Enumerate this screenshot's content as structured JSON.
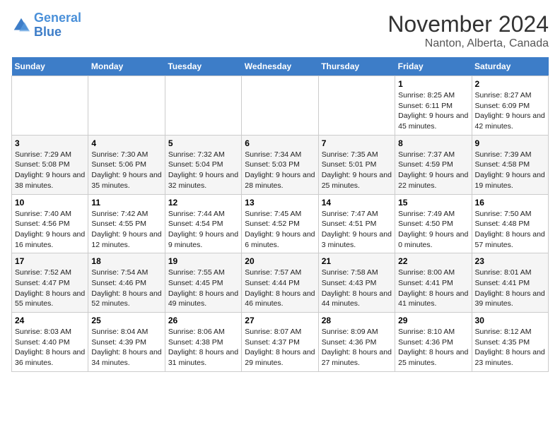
{
  "header": {
    "logo_line1": "General",
    "logo_line2": "Blue",
    "month": "November 2024",
    "location": "Nanton, Alberta, Canada"
  },
  "days_of_week": [
    "Sunday",
    "Monday",
    "Tuesday",
    "Wednesday",
    "Thursday",
    "Friday",
    "Saturday"
  ],
  "weeks": [
    [
      {
        "day": "",
        "info": ""
      },
      {
        "day": "",
        "info": ""
      },
      {
        "day": "",
        "info": ""
      },
      {
        "day": "",
        "info": ""
      },
      {
        "day": "",
        "info": ""
      },
      {
        "day": "1",
        "info": "Sunrise: 8:25 AM\nSunset: 6:11 PM\nDaylight: 9 hours and 45 minutes."
      },
      {
        "day": "2",
        "info": "Sunrise: 8:27 AM\nSunset: 6:09 PM\nDaylight: 9 hours and 42 minutes."
      }
    ],
    [
      {
        "day": "3",
        "info": "Sunrise: 7:29 AM\nSunset: 5:08 PM\nDaylight: 9 hours and 38 minutes."
      },
      {
        "day": "4",
        "info": "Sunrise: 7:30 AM\nSunset: 5:06 PM\nDaylight: 9 hours and 35 minutes."
      },
      {
        "day": "5",
        "info": "Sunrise: 7:32 AM\nSunset: 5:04 PM\nDaylight: 9 hours and 32 minutes."
      },
      {
        "day": "6",
        "info": "Sunrise: 7:34 AM\nSunset: 5:03 PM\nDaylight: 9 hours and 28 minutes."
      },
      {
        "day": "7",
        "info": "Sunrise: 7:35 AM\nSunset: 5:01 PM\nDaylight: 9 hours and 25 minutes."
      },
      {
        "day": "8",
        "info": "Sunrise: 7:37 AM\nSunset: 4:59 PM\nDaylight: 9 hours and 22 minutes."
      },
      {
        "day": "9",
        "info": "Sunrise: 7:39 AM\nSunset: 4:58 PM\nDaylight: 9 hours and 19 minutes."
      }
    ],
    [
      {
        "day": "10",
        "info": "Sunrise: 7:40 AM\nSunset: 4:56 PM\nDaylight: 9 hours and 16 minutes."
      },
      {
        "day": "11",
        "info": "Sunrise: 7:42 AM\nSunset: 4:55 PM\nDaylight: 9 hours and 12 minutes."
      },
      {
        "day": "12",
        "info": "Sunrise: 7:44 AM\nSunset: 4:54 PM\nDaylight: 9 hours and 9 minutes."
      },
      {
        "day": "13",
        "info": "Sunrise: 7:45 AM\nSunset: 4:52 PM\nDaylight: 9 hours and 6 minutes."
      },
      {
        "day": "14",
        "info": "Sunrise: 7:47 AM\nSunset: 4:51 PM\nDaylight: 9 hours and 3 minutes."
      },
      {
        "day": "15",
        "info": "Sunrise: 7:49 AM\nSunset: 4:50 PM\nDaylight: 9 hours and 0 minutes."
      },
      {
        "day": "16",
        "info": "Sunrise: 7:50 AM\nSunset: 4:48 PM\nDaylight: 8 hours and 57 minutes."
      }
    ],
    [
      {
        "day": "17",
        "info": "Sunrise: 7:52 AM\nSunset: 4:47 PM\nDaylight: 8 hours and 55 minutes."
      },
      {
        "day": "18",
        "info": "Sunrise: 7:54 AM\nSunset: 4:46 PM\nDaylight: 8 hours and 52 minutes."
      },
      {
        "day": "19",
        "info": "Sunrise: 7:55 AM\nSunset: 4:45 PM\nDaylight: 8 hours and 49 minutes."
      },
      {
        "day": "20",
        "info": "Sunrise: 7:57 AM\nSunset: 4:44 PM\nDaylight: 8 hours and 46 minutes."
      },
      {
        "day": "21",
        "info": "Sunrise: 7:58 AM\nSunset: 4:43 PM\nDaylight: 8 hours and 44 minutes."
      },
      {
        "day": "22",
        "info": "Sunrise: 8:00 AM\nSunset: 4:41 PM\nDaylight: 8 hours and 41 minutes."
      },
      {
        "day": "23",
        "info": "Sunrise: 8:01 AM\nSunset: 4:41 PM\nDaylight: 8 hours and 39 minutes."
      }
    ],
    [
      {
        "day": "24",
        "info": "Sunrise: 8:03 AM\nSunset: 4:40 PM\nDaylight: 8 hours and 36 minutes."
      },
      {
        "day": "25",
        "info": "Sunrise: 8:04 AM\nSunset: 4:39 PM\nDaylight: 8 hours and 34 minutes."
      },
      {
        "day": "26",
        "info": "Sunrise: 8:06 AM\nSunset: 4:38 PM\nDaylight: 8 hours and 31 minutes."
      },
      {
        "day": "27",
        "info": "Sunrise: 8:07 AM\nSunset: 4:37 PM\nDaylight: 8 hours and 29 minutes."
      },
      {
        "day": "28",
        "info": "Sunrise: 8:09 AM\nSunset: 4:36 PM\nDaylight: 8 hours and 27 minutes."
      },
      {
        "day": "29",
        "info": "Sunrise: 8:10 AM\nSunset: 4:36 PM\nDaylight: 8 hours and 25 minutes."
      },
      {
        "day": "30",
        "info": "Sunrise: 8:12 AM\nSunset: 4:35 PM\nDaylight: 8 hours and 23 minutes."
      }
    ]
  ]
}
